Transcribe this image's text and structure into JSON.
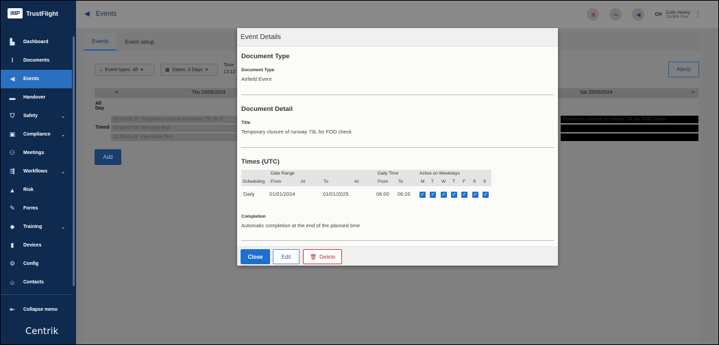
{
  "app": {
    "logo": "IMP",
    "brand": "TrustFlight",
    "footer_brand": "Centrik"
  },
  "sidebar": {
    "items": [
      {
        "label": "Dashboard",
        "icon": "dashboard-icon",
        "glyph": "▙",
        "chevron": false,
        "active": false
      },
      {
        "label": "Documents",
        "icon": "paperclip-icon",
        "glyph": "⌇",
        "chevron": false,
        "active": false
      },
      {
        "label": "Events",
        "icon": "megaphone-icon",
        "glyph": "◀",
        "chevron": false,
        "active": true
      },
      {
        "label": "Handover",
        "icon": "inbox-icon",
        "glyph": "▬",
        "chevron": false,
        "active": false
      },
      {
        "label": "Safety",
        "icon": "shield-icon",
        "glyph": "⛉",
        "chevron": true,
        "active": false
      },
      {
        "label": "Compliance",
        "icon": "clipboard-icon",
        "glyph": "▣",
        "chevron": true,
        "active": false
      },
      {
        "label": "Meetings",
        "icon": "people-icon",
        "glyph": "⚇",
        "chevron": false,
        "active": false
      },
      {
        "label": "Workflows",
        "icon": "workflow-icon",
        "glyph": "⇶",
        "chevron": true,
        "active": false
      },
      {
        "label": "Risk",
        "icon": "warning-icon",
        "glyph": "▲",
        "chevron": false,
        "active": false
      },
      {
        "label": "Forms",
        "icon": "form-icon",
        "glyph": "✎",
        "chevron": false,
        "active": false
      },
      {
        "label": "Training",
        "icon": "graduation-cap-icon",
        "glyph": "◆",
        "chevron": true,
        "active": false
      },
      {
        "label": "Devices",
        "icon": "devices-icon",
        "glyph": "▮",
        "chevron": false,
        "active": false
      },
      {
        "label": "Config",
        "icon": "config-icon",
        "glyph": "⚙",
        "chevron": false,
        "active": false
      },
      {
        "label": "Contacts",
        "icon": "contacts-icon",
        "glyph": "☺",
        "chevron": false,
        "active": false
      }
    ],
    "collapse_label": "Collapse menu"
  },
  "topbar": {
    "title": "Events",
    "user_initials": "CH",
    "user_name": "Colin Harley",
    "user_role": "Centrik User"
  },
  "main": {
    "tabs": [
      {
        "label": "Events",
        "active": true
      },
      {
        "label": "Event setup",
        "active": false
      }
    ],
    "filter_event_types": "Event types: All",
    "filter_dates": "Dates: 3 Days",
    "time_label_top": "Time",
    "time_label_bottom": "13:12",
    "alerts_label": "Alerts",
    "cal_prev": "<",
    "cal_next": ">",
    "cal_day1": "Thu 23/05/2024",
    "cal_day3": "Sat 25/05/2024",
    "row_all_day_1": "All",
    "row_all_day_2": "Day",
    "row_timed": "Timed",
    "events": [
      "06:00-06:20: Temporary closure of runway 73L for F",
      "07:00-07:15: Fire Drill Test",
      "11:00-11:45: Fire Alarm Test"
    ],
    "right_event": "Temporary closure of runway 73L for FOD check",
    "add_label": "Add"
  },
  "modal": {
    "title": "Event Details",
    "doc_type_section": "Document Type",
    "doc_type_label": "Document Type",
    "doc_type_value": "Airfield Event",
    "doc_detail_section": "Document Detail",
    "title_label": "Title",
    "title_value": "Temporary closure of runway 73L for FOD check",
    "times_section": "Times (UTC)",
    "table": {
      "group_date_range": "Date Range",
      "group_daily_time": "Daily Time",
      "group_weekdays": "Active on Weekdays",
      "col_scheduling": "Scheduling",
      "col_from": "From",
      "col_at": "At",
      "col_to": "To",
      "col_at2": "At",
      "col_dt_from": "From",
      "col_dt_to": "To",
      "weekday_headers": [
        "M",
        "T",
        "W",
        "T",
        "F",
        "S",
        "S"
      ],
      "row": {
        "scheduling": "Daily",
        "from": "01/01/2024",
        "to": "01/01/2025",
        "daily_from": "06:00",
        "daily_to": "06:20",
        "weekdays_checked": [
          true,
          true,
          true,
          true,
          true,
          true,
          true
        ]
      }
    },
    "completion_label": "Completion",
    "completion_value": "Automatic completion at the end of the planned time",
    "close_label": "Close",
    "edit_label": "Edit",
    "delete_label": "Delete"
  },
  "colors": {
    "sidebar_bg": "#0f2a4f",
    "accent": "#1f6fd1",
    "danger": "#c0302b"
  }
}
